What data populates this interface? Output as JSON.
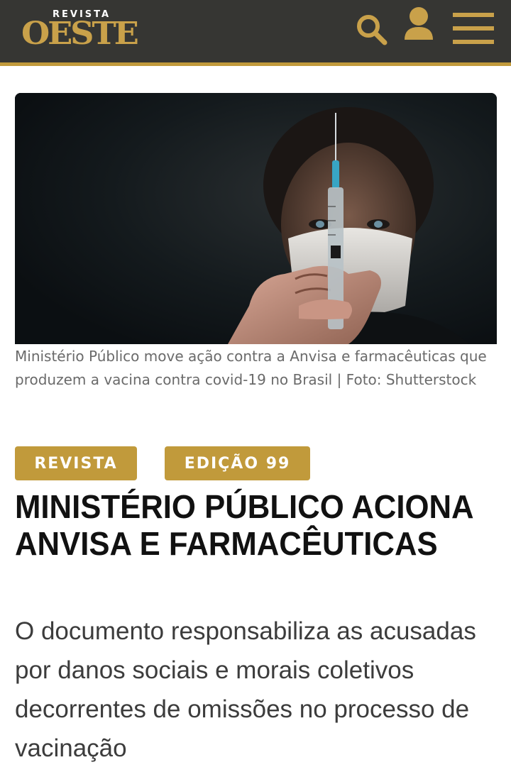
{
  "header": {
    "logo_small": "REVISTA",
    "logo_big": "OESTE",
    "search_icon": "search-icon",
    "user_icon": "user-icon",
    "menu_icon": "hamburger-menu-icon",
    "brand_color": "#c19a3b",
    "bar_color": "#363633"
  },
  "article": {
    "image_alt": "Homem de máscara segurando seringa",
    "caption": "Ministério Público move ação contra a Anvisa e farmacêuticas que produzem a vacina contra covid-19 no Brasil | Foto: Shutterstock",
    "tags": [
      "REVISTA",
      "EDIÇÃO 99"
    ],
    "headline": "MINISTÉRIO PÚBLICO ACIONA ANVISA E FARMACÊUTICAS",
    "subtitle": "O documento responsabiliza as acusadas por danos sociais e morais coletivos decorrentes de omissões no processo de vacinação"
  }
}
